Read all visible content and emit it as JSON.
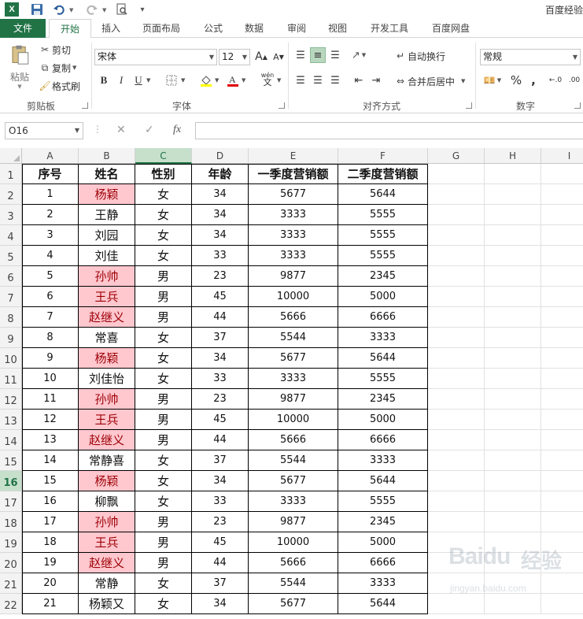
{
  "titlebar": {
    "app_logo": "X",
    "window_title": "百度经验"
  },
  "tabs": [
    {
      "label": "文件"
    },
    {
      "label": "开始"
    },
    {
      "label": "插入"
    },
    {
      "label": "页面布局"
    },
    {
      "label": "公式"
    },
    {
      "label": "数据"
    },
    {
      "label": "审阅"
    },
    {
      "label": "视图"
    },
    {
      "label": "开发工具"
    },
    {
      "label": "百度网盘"
    }
  ],
  "ribbon": {
    "clipboard": {
      "paste": "粘贴",
      "cut": "剪切",
      "copy": "复制",
      "format_painter": "格式刷",
      "group": "剪贴板"
    },
    "font": {
      "name": "宋体",
      "size": "12",
      "group": "字体",
      "bold": "B",
      "italic": "I",
      "underline": "U",
      "grow": "A",
      "shrink": "A",
      "phonetic": "wén"
    },
    "alignment": {
      "wrap": "自动换行",
      "merge": "合并后居中",
      "group": "对齐方式"
    },
    "number": {
      "format": "常规",
      "group": "数字",
      "percent": "%",
      "comma": ","
    }
  },
  "formula_bar": {
    "name_box": "O16",
    "fx": "fx",
    "formula": ""
  },
  "grid": {
    "selected_column": "C",
    "selected_row": "16",
    "columns": [
      "A",
      "B",
      "C",
      "D",
      "E",
      "F",
      "G",
      "H",
      "I"
    ],
    "row_numbers": [
      "1",
      "2",
      "3",
      "4",
      "5",
      "6",
      "7",
      "8",
      "9",
      "10",
      "11",
      "12",
      "13",
      "14",
      "15",
      "16",
      "17",
      "18",
      "19",
      "20",
      "21",
      "22"
    ],
    "header": [
      "序号",
      "姓名",
      "性别",
      "年龄",
      "一季度营销额",
      "二季度营销额"
    ],
    "rows": [
      {
        "no": "1",
        "name": "杨颖",
        "sex": "女",
        "age": "34",
        "q1": "5677",
        "q2": "5644",
        "dup": true
      },
      {
        "no": "2",
        "name": "王静",
        "sex": "女",
        "age": "34",
        "q1": "3333",
        "q2": "5555",
        "dup": false
      },
      {
        "no": "3",
        "name": "刘园",
        "sex": "女",
        "age": "34",
        "q1": "3333",
        "q2": "5555",
        "dup": false
      },
      {
        "no": "4",
        "name": "刘佳",
        "sex": "女",
        "age": "33",
        "q1": "3333",
        "q2": "5555",
        "dup": false
      },
      {
        "no": "5",
        "name": "孙帅",
        "sex": "男",
        "age": "23",
        "q1": "9877",
        "q2": "2345",
        "dup": true
      },
      {
        "no": "6",
        "name": "王兵",
        "sex": "男",
        "age": "45",
        "q1": "10000",
        "q2": "5000",
        "dup": true
      },
      {
        "no": "7",
        "name": "赵继义",
        "sex": "男",
        "age": "44",
        "q1": "5666",
        "q2": "6666",
        "dup": true
      },
      {
        "no": "8",
        "name": "常喜",
        "sex": "女",
        "age": "37",
        "q1": "5544",
        "q2": "3333",
        "dup": false
      },
      {
        "no": "9",
        "name": "杨颖",
        "sex": "女",
        "age": "34",
        "q1": "5677",
        "q2": "5644",
        "dup": true
      },
      {
        "no": "10",
        "name": "刘佳怡",
        "sex": "女",
        "age": "33",
        "q1": "3333",
        "q2": "5555",
        "dup": false
      },
      {
        "no": "11",
        "name": "孙帅",
        "sex": "男",
        "age": "23",
        "q1": "9877",
        "q2": "2345",
        "dup": true
      },
      {
        "no": "12",
        "name": "王兵",
        "sex": "男",
        "age": "45",
        "q1": "10000",
        "q2": "5000",
        "dup": true
      },
      {
        "no": "13",
        "name": "赵继义",
        "sex": "男",
        "age": "44",
        "q1": "5666",
        "q2": "6666",
        "dup": true
      },
      {
        "no": "14",
        "name": "常静喜",
        "sex": "女",
        "age": "37",
        "q1": "5544",
        "q2": "3333",
        "dup": false
      },
      {
        "no": "15",
        "name": "杨颖",
        "sex": "女",
        "age": "34",
        "q1": "5677",
        "q2": "5644",
        "dup": true
      },
      {
        "no": "16",
        "name": "柳飘",
        "sex": "女",
        "age": "33",
        "q1": "3333",
        "q2": "5555",
        "dup": false
      },
      {
        "no": "17",
        "name": "孙帅",
        "sex": "男",
        "age": "23",
        "q1": "9877",
        "q2": "2345",
        "dup": true
      },
      {
        "no": "18",
        "name": "王兵",
        "sex": "男",
        "age": "45",
        "q1": "10000",
        "q2": "5000",
        "dup": true
      },
      {
        "no": "19",
        "name": "赵继义",
        "sex": "男",
        "age": "44",
        "q1": "5666",
        "q2": "6666",
        "dup": true
      },
      {
        "no": "20",
        "name": "常静",
        "sex": "女",
        "age": "37",
        "q1": "5544",
        "q2": "3333",
        "dup": false
      },
      {
        "no": "21",
        "name": "杨颖又",
        "sex": "女",
        "age": "34",
        "q1": "5677",
        "q2": "5644",
        "dup": false
      }
    ]
  },
  "watermark": {
    "brand": "Baidu",
    "cn": "经验",
    "url": "jingyan.baidu.com"
  },
  "colors": {
    "excel_green": "#217346",
    "dup_fill": "#ffc7ce",
    "dup_text": "#9c0006",
    "selected_header": "#c6e0cc"
  },
  "icons": [
    "excel-logo-icon",
    "save-icon",
    "undo-icon",
    "redo-icon",
    "print-preview-icon",
    "paste-icon",
    "cut-icon",
    "copy-icon",
    "format-painter-icon",
    "border-icon",
    "fill-color-icon",
    "font-color-icon",
    "align-top-icon",
    "align-middle-icon",
    "align-bottom-icon",
    "orientation-icon",
    "align-left-icon",
    "align-center-icon",
    "align-right-icon",
    "decrease-indent-icon",
    "increase-indent-icon",
    "wrap-text-icon",
    "merge-center-icon",
    "accounting-format-icon",
    "increase-decimal-icon",
    "decrease-decimal-icon",
    "cancel-icon",
    "enter-icon"
  ]
}
